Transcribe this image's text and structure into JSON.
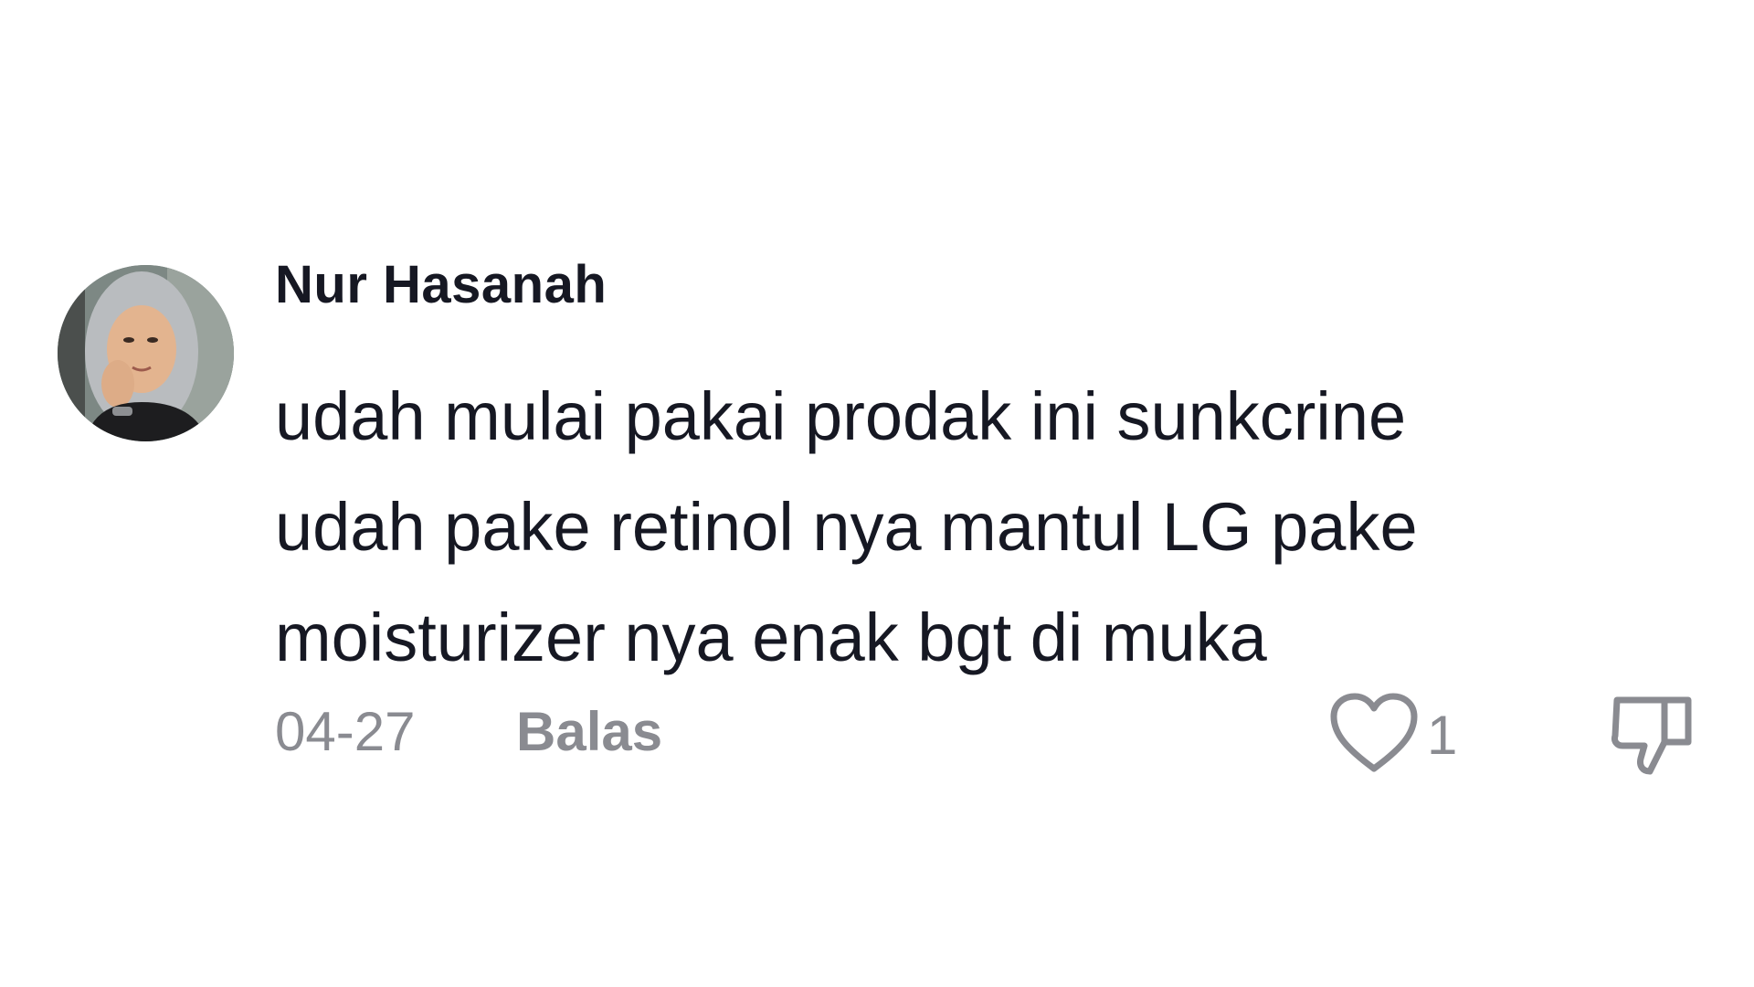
{
  "comment": {
    "username": "Nur Hasanah",
    "text_lines": [
      "udah mulai pakai prodak ini sunkcrine",
      "udah pake retinol nya mantul LG pake",
      "moisturizer nya enak bgt di muka"
    ],
    "date": "04-27",
    "reply_label": "Balas",
    "like_count": "1",
    "liked": false
  },
  "icons": {
    "like": "heart-outline-icon",
    "dislike": "thumbs-down-outline-icon"
  },
  "colors": {
    "text_primary": "#161823",
    "text_secondary": "#8a8b91",
    "background": "#ffffff"
  }
}
